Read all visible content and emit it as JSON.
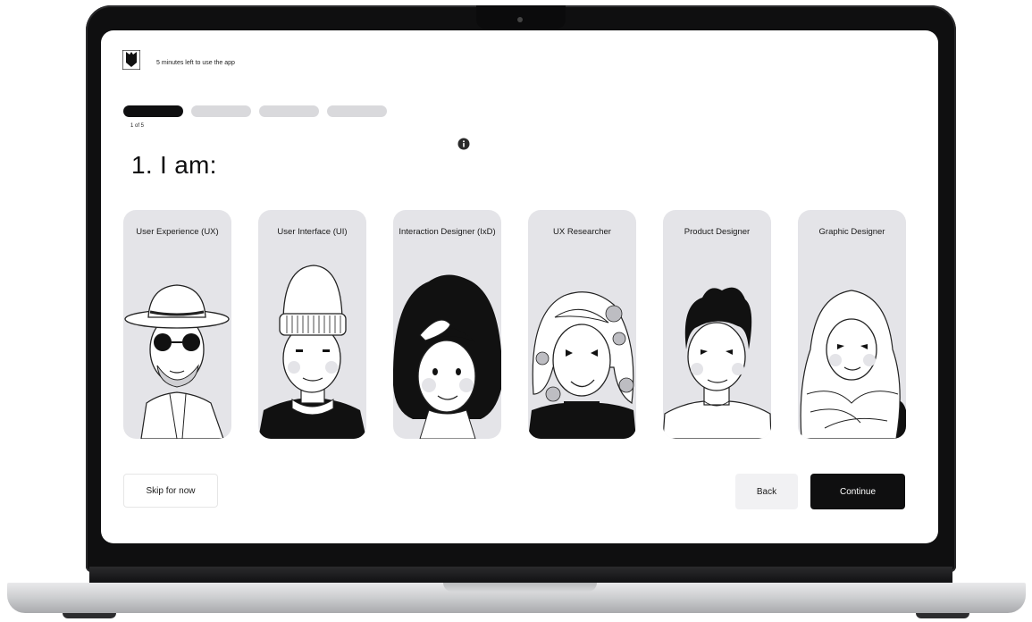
{
  "header": {
    "timer_text": "5 minutes left to use the app"
  },
  "progress": {
    "current_step": 1,
    "total_steps": 5,
    "label": "1 of 5"
  },
  "question": {
    "title": "1. I am:"
  },
  "roles": [
    {
      "label": "User Experience (UX)"
    },
    {
      "label": "User Interface (UI)"
    },
    {
      "label": "Interaction Designer (IxD)"
    },
    {
      "label": "UX Researcher"
    },
    {
      "label": "Product Designer"
    },
    {
      "label": "Graphic Designer"
    }
  ],
  "actions": {
    "skip_label": "Skip for now",
    "back_label": "Back",
    "continue_label": "Continue"
  },
  "icons": {
    "logo": "app-logo-icon",
    "info": "info-icon"
  },
  "colors": {
    "accent": "#0f0f10",
    "card_background": "#e4e4e8",
    "progress_inactive": "#d9d9dc"
  }
}
